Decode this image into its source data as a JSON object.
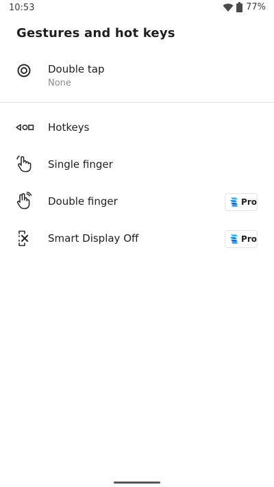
{
  "status_bar": {
    "time": "10:53",
    "battery": "77%",
    "icons": [
      "wifi-icon",
      "battery-icon"
    ]
  },
  "page": {
    "title": "Gestures and hot keys"
  },
  "items": [
    {
      "label": "Double tap",
      "sublabel": "None",
      "icon": "target-icon",
      "pro": false
    },
    {
      "label": "Hotkeys",
      "icon": "hotkeys-icon",
      "pro": false
    },
    {
      "label": "Single finger",
      "icon": "single-finger-icon",
      "pro": false
    },
    {
      "label": "Double finger",
      "icon": "double-finger-icon",
      "pro": true
    },
    {
      "label": "Smart Display Off",
      "icon": "smart-display-off-icon",
      "pro": true
    }
  ],
  "pro_badge": {
    "label": "Pro",
    "colors": {
      "primary": "#1e88e5",
      "secondary": "#29b6f6"
    }
  }
}
